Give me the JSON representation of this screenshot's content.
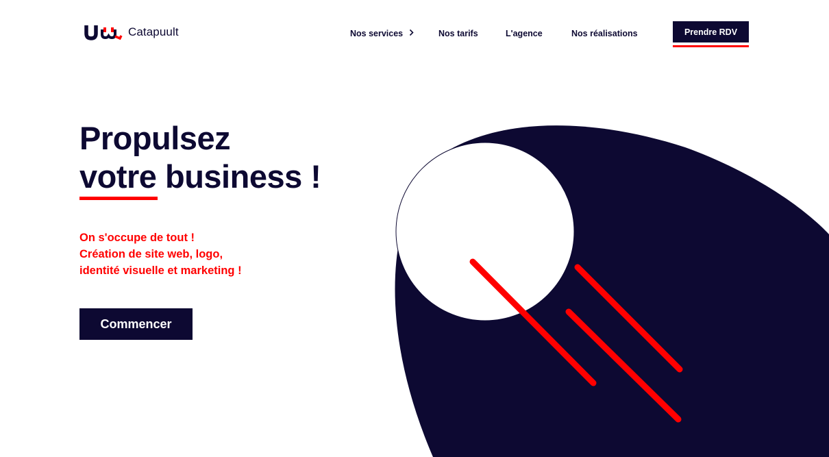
{
  "brand": {
    "name": "Catapuult",
    "logo_icon": "catapuult-logo-icon",
    "colors": {
      "navy": "#0d0932",
      "red": "#ff0000",
      "white": "#ffffff"
    }
  },
  "nav": {
    "items": [
      {
        "label": "Nos services",
        "has_submenu": true,
        "icon": "chevron-right-icon"
      },
      {
        "label": "Nos tarifs",
        "has_submenu": false
      },
      {
        "label": "L'agence",
        "has_submenu": false
      },
      {
        "label": "Nos réalisations",
        "has_submenu": false
      }
    ],
    "cta_label": "Prendre RDV"
  },
  "hero": {
    "title_line1": "Propulsez",
    "title_line2": "votre business !",
    "subtitle_lines": [
      "On s'occupe de tout !",
      "Création de site web, logo,",
      "identité visuelle et marketing !"
    ],
    "cta_label": "Commencer"
  },
  "illustration": {
    "description_icon": "comet-illustration"
  }
}
